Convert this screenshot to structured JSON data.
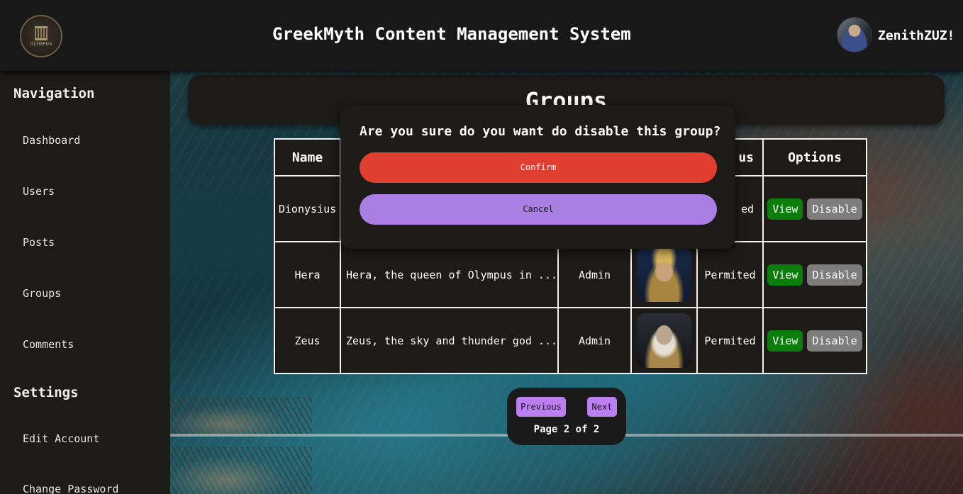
{
  "header": {
    "logo_text": "OLYMPUS",
    "title": "GreekMyth Content Management System",
    "username": "ZenithZUZ!"
  },
  "sidebar": {
    "navigation_heading": "Navigation",
    "nav_items": [
      {
        "label": "Dashboard"
      },
      {
        "label": "Users"
      },
      {
        "label": "Posts"
      },
      {
        "label": "Groups"
      },
      {
        "label": "Comments"
      }
    ],
    "settings_heading": "Settings",
    "settings_items": [
      {
        "label": "Edit Account"
      },
      {
        "label": "Change Password"
      }
    ]
  },
  "main": {
    "page_title": "Groups",
    "table": {
      "headers": [
        "Name",
        "",
        "",
        "",
        "us",
        "Options"
      ],
      "rows": [
        {
          "name": "Dionysius",
          "description": "",
          "author": "",
          "status": "ed",
          "view": "View",
          "disable": "Disable"
        },
        {
          "name": "Hera",
          "description": "Hera, the queen of Olympus in ...",
          "author": "Admin",
          "status": "Permited",
          "view": "View",
          "disable": "Disable"
        },
        {
          "name": "Zeus",
          "description": "Zeus, the sky and thunder god ...",
          "author": "Admin",
          "status": "Permited",
          "view": "View",
          "disable": "Disable"
        }
      ]
    },
    "pagination": {
      "previous": "Previous",
      "next": "Next",
      "label": "Page 2 of 2"
    }
  },
  "modal": {
    "question": "Are you sure do you want do disable this group?",
    "confirm": "Confirm",
    "cancel": "Cancel"
  },
  "colors": {
    "confirm": "#e03e31",
    "cancel": "#a97fe4",
    "view": "#0a7d0a",
    "disable": "#7d7d7d",
    "pager_button": "#bb7ff0"
  }
}
